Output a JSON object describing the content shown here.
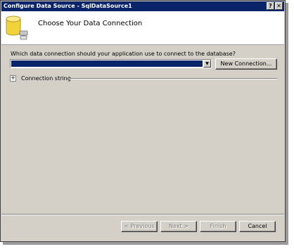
{
  "window": {
    "title": "Configure Data Source - SqlDataSource1",
    "help_glyph": "?",
    "close_glyph": "✕"
  },
  "header": {
    "title": "Choose Your Data Connection",
    "icon": "database-icon"
  },
  "connection": {
    "question": "Which data connection should your application use to connect to the database?",
    "selected_value": "",
    "arrow_glyph": "▼",
    "new_connection_label": "New Connection...",
    "expand_glyph": "+",
    "connection_string_label": "Connection string"
  },
  "footer": {
    "previous_label": "< Previous",
    "next_label": "Next >",
    "finish_label": "Finish",
    "cancel_label": "Cancel"
  },
  "colors": {
    "titlebar": "#0a246a",
    "dialog_face": "#d4d0c8",
    "selection": "#0a246a",
    "icon_yellow": "#f2d23a"
  }
}
